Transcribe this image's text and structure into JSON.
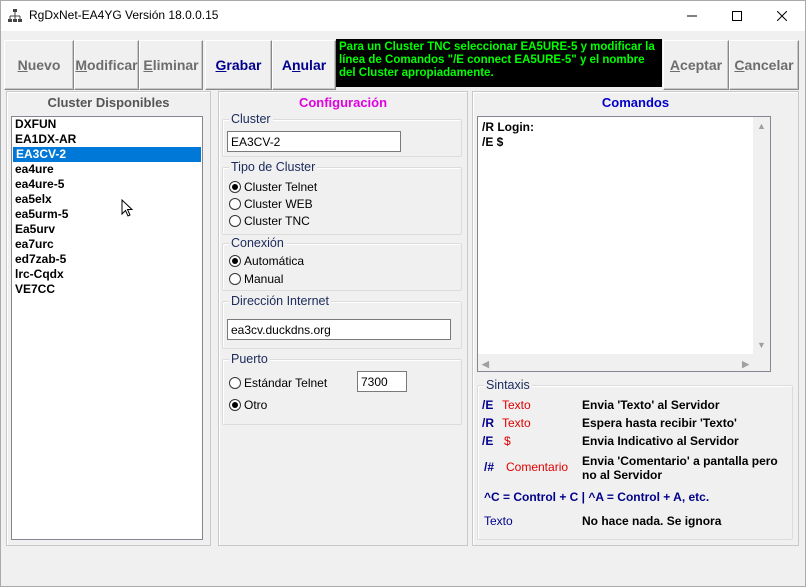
{
  "window": {
    "title": "RgDxNet-EA4YG Versión  18.0.0.15",
    "minimize_label": "—",
    "maximize_label": "☐",
    "close_label": "✕"
  },
  "toolbar": {
    "nuevo": {
      "pre": "",
      "u": "N",
      "post": "uevo"
    },
    "modificar": {
      "pre": "",
      "u": "M",
      "post": "odificar"
    },
    "eliminar": {
      "pre": "",
      "u": "E",
      "post": "liminar"
    },
    "grabar": {
      "pre": "",
      "u": "G",
      "post": "rabar"
    },
    "anular": {
      "pre": "A",
      "u": "n",
      "post": "ular"
    },
    "aceptar": {
      "pre": "",
      "u": "A",
      "post": "ceptar"
    },
    "cancelar": {
      "pre": "",
      "u": "C",
      "post": "ancelar"
    },
    "notice": "Para un Cluster TNC seleccionar EA5URE-5 y modificar la línea de Comandos \"/E connect EA5URE-5\" y el nombre del Cluster apropiadamente."
  },
  "clusters": {
    "title": "Cluster Disponibles",
    "items": [
      "DXFUN",
      "EA1DX-AR",
      "EA3CV-2",
      "ea4ure",
      "ea4ure-5",
      "ea5elx",
      "ea5urm-5",
      "Ea5urv",
      "ea7urc",
      "ed7zab-5",
      "lrc-Cqdx",
      "VE7CC"
    ],
    "selected": "EA3CV-2"
  },
  "config": {
    "title": "Configuración",
    "cluster_legend": "Cluster",
    "cluster_value": "EA3CV-2",
    "tipo_legend": "Tipo de Cluster",
    "tipo_options": [
      "Cluster Telnet",
      "Cluster WEB",
      "Cluster TNC"
    ],
    "tipo_selected": "Cluster Telnet",
    "conexion_legend": "Conexión",
    "conexion_options": [
      "Automática",
      "Manual"
    ],
    "conexion_selected": "Automática",
    "direccion_legend": "Dirección Internet",
    "direccion_value": "ea3cv.duckdns.org",
    "puerto_legend": "Puerto",
    "puerto_options": [
      "Estándar Telnet",
      "Otro"
    ],
    "puerto_selected": "Otro",
    "puerto_value": "7300"
  },
  "comandos": {
    "title": "Comandos",
    "lines": [
      "/R Login:",
      "/E $"
    ],
    "sintaxis_legend": "Sintaxis",
    "rows": [
      {
        "cmd": "/E",
        "arg": "Texto",
        "desc": "Envia 'Texto' al Servidor"
      },
      {
        "cmd": "/R",
        "arg": "Texto",
        "desc": "Espera hasta recibir 'Texto'"
      },
      {
        "cmd": "/E",
        "arg": "$",
        "desc": "Envia Indicativo al Servidor"
      },
      {
        "cmd": "/#",
        "arg": "Comentario",
        "desc": "Envia 'Comentario' a pantalla pero no al Servidor"
      }
    ],
    "ctrl_note": "^C = Control + C | ^A = Control + A, etc.",
    "texto_label": "Texto",
    "texto_desc": "No hace nada. Se ignora"
  },
  "colors": {
    "selection": "#0078d7",
    "config_title": "#e000e0",
    "comandos_title": "#0000cc",
    "notice_bg": "#000000",
    "notice_text": "#00ff00"
  }
}
